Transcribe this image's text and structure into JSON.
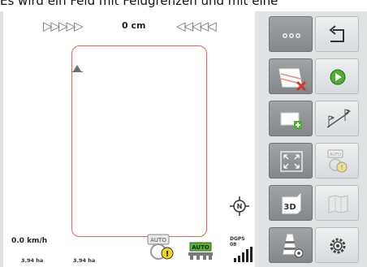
{
  "caption": "Es wird ein Feld mit Feldgrenzen und mit eine",
  "guidance": {
    "offset_value": "0 cm",
    "left_arrows_icon": "chevron-right-icons",
    "right_arrows_icon": "chevron-left-icons"
  },
  "status": {
    "speed": "0.0 km/h",
    "area_1": "3.94 ha",
    "area_2": "3.94 ha",
    "steer_label": "AUTO",
    "section_label": "AUTO",
    "gps_label": "DGPS",
    "gps_value": "08"
  },
  "buttons": {
    "more_icon": "more-icon",
    "back_icon": "back-icon",
    "delete_boundary_icon": "delete-boundary-icon",
    "play_icon": "play-icon",
    "add_field_icon": "add-field-icon",
    "ab_line_icon": "ab-line-icon",
    "zoom_icon": "zoom-extents-icon",
    "auto_warning_label": "AUTO",
    "view_3d_label": "3D",
    "map_icon": "map-icon",
    "obstacle_icon": "obstacle-settings-icon",
    "settings_icon": "gear-icon"
  },
  "colors": {
    "field_border": "#e6625a",
    "play_green": "#4caf32",
    "delete_red": "#d2362e"
  }
}
